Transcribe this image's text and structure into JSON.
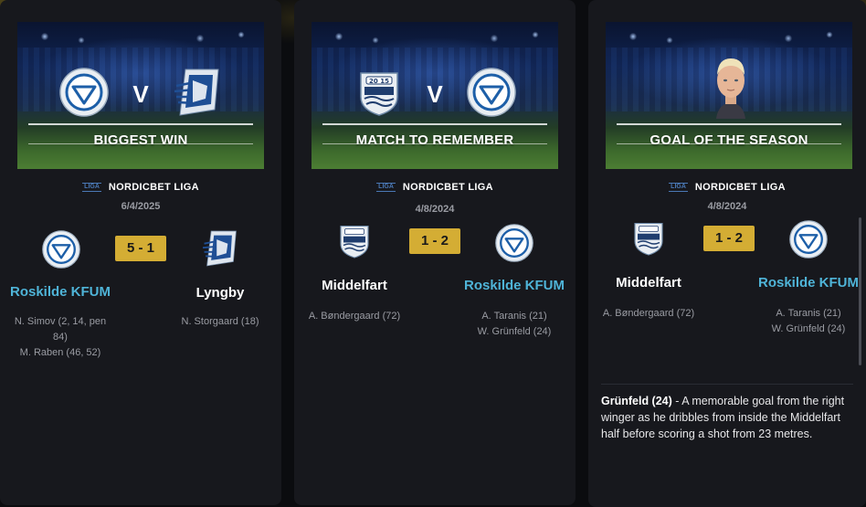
{
  "cards": [
    {
      "banner_title": "BIGGEST WIN",
      "vs": "V",
      "league": {
        "logo_text": "LIGA",
        "name": "NORDICBET LIGA"
      },
      "date": "6/4/2025",
      "score": "5 - 1",
      "home": {
        "name": "Roskilde KFUM",
        "logo": "roskilde-kfum-crest",
        "scorers": [
          "N. Simov (2, 14, pen\n84)",
          "M. Raben (46, 52)"
        ]
      },
      "away": {
        "name": "Lyngby",
        "logo": "lyngby-crest",
        "scorers": [
          "N. Storgaard (18)"
        ]
      }
    },
    {
      "banner_title": "MATCH TO REMEMBER",
      "vs": "V",
      "league": {
        "logo_text": "LIGA",
        "name": "NORDICBET LIGA"
      },
      "date": "4/8/2024",
      "score": "1 - 2",
      "home": {
        "name": "Middelfart",
        "logo": "middelfart-crest",
        "scorers": [
          "A. Bøndergaard (72)"
        ]
      },
      "away": {
        "name": "Roskilde KFUM",
        "logo": "roskilde-kfum-crest",
        "scorers": [
          "A. Taranis (21)",
          "W. Grünfeld (24)"
        ]
      }
    },
    {
      "banner_title": "GOAL OF THE SEASON",
      "league": {
        "logo_text": "LIGA",
        "name": "NORDICBET LIGA"
      },
      "date": "4/8/2024",
      "score": "1 - 2",
      "home": {
        "name": "Middelfart",
        "logo": "middelfart-crest",
        "scorers": [
          "A. Bøndergaard (72)"
        ]
      },
      "away": {
        "name": "Roskilde KFUM",
        "logo": "roskilde-kfum-crest",
        "scorers": [
          "A. Taranis (21)",
          "W. Grünfeld (24)"
        ]
      },
      "description": {
        "scorer": "Grünfeld (24)",
        "text": " - A memorable goal from the right winger as he dribbles from inside the Middelfart half before scoring a shot from 23 metres."
      }
    }
  ],
  "colors": {
    "winner_text": "#4fb4d8",
    "score_badge": "#d4ad34",
    "card_bg": "#17181d",
    "page_bg": "#0b0c0f"
  }
}
